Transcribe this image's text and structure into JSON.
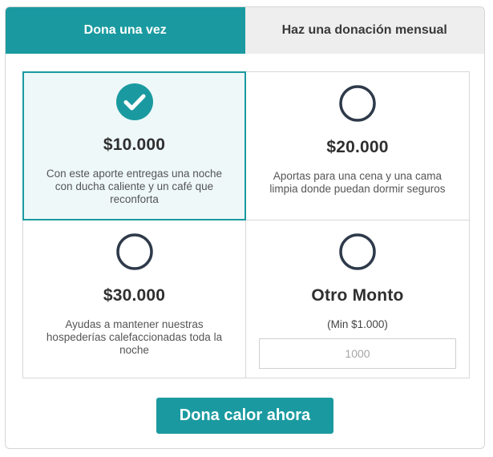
{
  "tabs": [
    {
      "label": "Dona una vez",
      "active": true
    },
    {
      "label": "Haz una donación mensual",
      "active": false
    }
  ],
  "options": [
    {
      "amount": "$10.000",
      "description": "Con este aporte entregas una noche con ducha caliente y un café que reconforta",
      "selected": true
    },
    {
      "amount": "$20.000",
      "description": "Aportas para una cena y una cama limpia donde puedan dormir seguros",
      "selected": false
    },
    {
      "amount": "$30.000",
      "description": "Ayudas a mantener nuestras hospederías calefaccionadas toda la noche",
      "selected": false
    }
  ],
  "other": {
    "label": "Otro Monto",
    "min_text": "(Min $1.000)",
    "placeholder": "1000",
    "selected": false
  },
  "cta": {
    "label": "Dona calor ahora"
  },
  "colors": {
    "accent": "#1a9aa0",
    "radio_border": "#2e3a4a",
    "selected_bg": "#eef8f9"
  },
  "icons": {
    "selected": "check-circle-icon",
    "unselected": "radio-empty-icon"
  }
}
